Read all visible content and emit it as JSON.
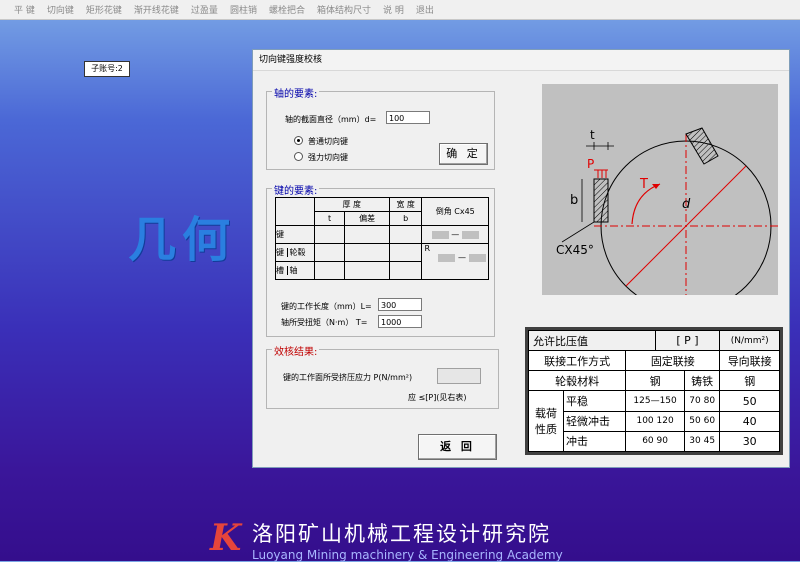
{
  "menu": [
    "平 键",
    "切向键",
    "矩形花键",
    "渐开线花键",
    "过盈量",
    "圆柱销",
    "螺栓把合",
    "箱体结构尺寸",
    "说 明",
    "退出"
  ],
  "sub_account": "子账号:2",
  "big_title": "几何",
  "dialog": {
    "title": "切向键强度校核",
    "shaft": {
      "legend": "轴的要素:",
      "diameter_label": "轴的截面直径（mm）d=",
      "diameter_value": "100",
      "radio_normal": "普通切向键",
      "radio_strong": "强力切向键",
      "confirm_button": "确 定"
    },
    "key": {
      "legend": "键的要素:",
      "hdr_thickness": "厚 度",
      "hdr_width": "宽 度",
      "hdr_chamfer": "倒角 Cx45",
      "hdr_t": "t",
      "hdr_dev": "偏差",
      "hdr_b": "b",
      "row_key": "键",
      "row_slot_a": "键",
      "row_slot_b": "槽",
      "row_hub": "轮毂",
      "row_shaft": "轴",
      "r_label": "R",
      "length_label": "键的工作长度（mm）L=",
      "length_value": "300",
      "torque_label": "轴所受扭矩（N·m） T=",
      "torque_value": "1000"
    },
    "result": {
      "legend": "效核结果:",
      "stress_label": "键的工作面所受挤压应力 P(N/mm²)",
      "stress_value": "",
      "compare_note": "应 ≤[P](见右表)"
    },
    "back_button": "返 回",
    "drawing_labels": {
      "t": "t",
      "p": "P",
      "torque": "T",
      "d": "d",
      "b": "b",
      "chamfer": "CX45°"
    },
    "allow_table": {
      "title": "允许比压值",
      "unit_symbol": "[ P ]",
      "unit": "(N/mm²)",
      "join_mode_label": "联接工作方式",
      "fixed_join": "固定联接",
      "guided_join": "导向联接",
      "hub_material_label": "轮毂材料",
      "steel": "钢",
      "cast_iron": "铸铁",
      "steel2": "钢",
      "load_label_a": "载荷",
      "load_label_b": "性质",
      "rows": [
        {
          "name": "平稳",
          "steel": "125—150",
          "iron": "70 80",
          "guided": "50"
        },
        {
          "name": "轻微冲击",
          "steel": "100 120",
          "iron": "50 60",
          "guided": "40"
        },
        {
          "name": "冲击",
          "steel": "60 90",
          "iron": "30 45",
          "guided": "30"
        }
      ]
    }
  },
  "footer": {
    "logo": "K",
    "cn": "洛阳矿山机械工程设计研究院",
    "en": "Luoyang Mining machinery & Engineering Academy"
  },
  "colors": {
    "accent": "#2a7fe0",
    "legend_blue": "#0000aa",
    "legend_red": "#c00000",
    "logo_red": "#e6453b"
  }
}
